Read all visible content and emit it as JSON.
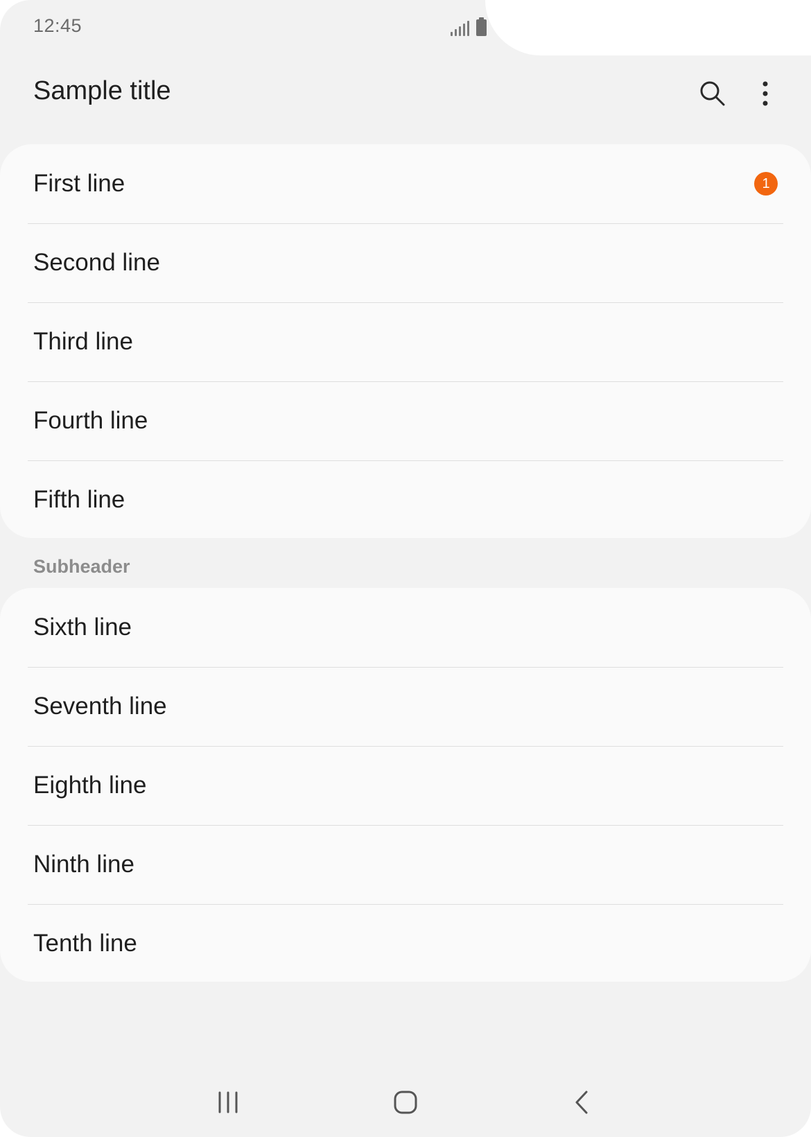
{
  "status_bar": {
    "time": "12:45",
    "icons": [
      "signal-icon",
      "battery-icon"
    ]
  },
  "app_bar": {
    "title": "Sample title",
    "actions": [
      "search-icon",
      "more-vert-icon"
    ]
  },
  "group_1": {
    "items": [
      {
        "label": "First line",
        "badge": "1"
      },
      {
        "label": "Second line"
      },
      {
        "label": "Third line"
      },
      {
        "label": "Fourth line"
      },
      {
        "label": "Fifth line"
      }
    ]
  },
  "subheader": "Subheader",
  "group_2": {
    "items": [
      {
        "label": "Sixth line"
      },
      {
        "label": "Seventh line"
      },
      {
        "label": "Eighth line"
      },
      {
        "label": "Ninth line"
      },
      {
        "label": "Tenth line"
      }
    ]
  },
  "nav_bar": {
    "buttons": [
      "recents-icon",
      "home-icon",
      "back-icon"
    ]
  },
  "colors": {
    "background": "#f2f2f2",
    "card": "#fafafa",
    "badge": "#f2660f",
    "text": "#1f1f1f",
    "subheader": "#8c8c8c"
  }
}
